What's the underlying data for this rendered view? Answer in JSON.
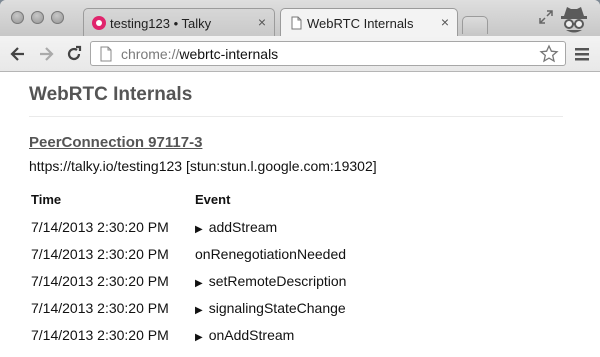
{
  "browser": {
    "tabs": [
      {
        "title": "testing123 • Talky",
        "close": "×",
        "active": false
      },
      {
        "title": "WebRTC Internals",
        "close": "×",
        "active": true
      }
    ],
    "omnibox": {
      "scheme": "chrome://",
      "host": "webrtc-internals"
    },
    "icons": [
      "back-arrow-icon",
      "forward-arrow-icon",
      "reload-icon",
      "page-icon",
      "star-icon",
      "menu-icon",
      "fullscreen-icon",
      "incognito-icon"
    ]
  },
  "page": {
    "title": "WebRTC Internals",
    "peer_connection": {
      "heading": "PeerConnection 97117-3",
      "url": "https://talky.io/testing123 [stun:stun.l.google.com:19302]"
    },
    "table": {
      "headers": [
        "Time",
        "Event"
      ],
      "rows": [
        {
          "time": "7/14/2013 2:30:20 PM",
          "event": "addStream",
          "expandable": true
        },
        {
          "time": "7/14/2013 2:30:20 PM",
          "event": "onRenegotiationNeeded",
          "expandable": false
        },
        {
          "time": "7/14/2013 2:30:20 PM",
          "event": "setRemoteDescription",
          "expandable": true
        },
        {
          "time": "7/14/2013 2:30:20 PM",
          "event": "signalingStateChange",
          "expandable": true
        },
        {
          "time": "7/14/2013 2:30:20 PM",
          "event": "onAddStream",
          "expandable": true
        }
      ],
      "expand_glyph": "▶"
    }
  },
  "colors": {
    "talky_brand": "#e0246c",
    "heading_gray": "#555555"
  }
}
